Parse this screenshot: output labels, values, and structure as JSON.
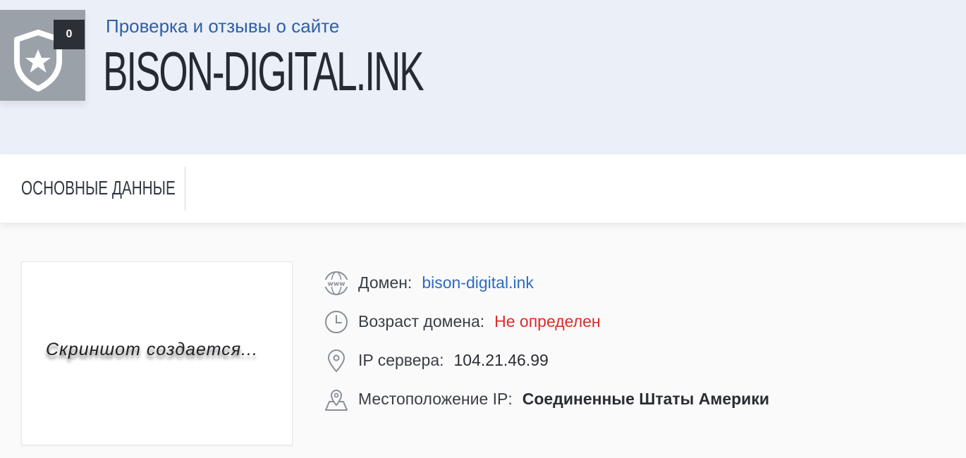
{
  "header": {
    "subtitle": "Проверка и отзывы о сайте",
    "title": "BISON-DIGITAL.INK",
    "badge_count": "0",
    "badge_icon": "shield-star-icon"
  },
  "tabs": [
    {
      "label": "ОСНОВНЫЕ ДАННЫЕ"
    }
  ],
  "preview": {
    "text": "Скриншот создается..."
  },
  "info": {
    "domain": {
      "icon": "www-globe-icon",
      "label": "Домен:",
      "value": "bison-digital.ink"
    },
    "age": {
      "icon": "clock-icon",
      "label": "Возраст домена:",
      "value": "Не определен"
    },
    "ip": {
      "icon": "map-pin-icon",
      "label": "IP сервера:",
      "value": "104.21.46.99"
    },
    "location": {
      "icon": "map-location-icon",
      "label": "Местоположение IP:",
      "value": "Соединенные Штаты Америки"
    }
  },
  "colors": {
    "header_bg": "#ebeff8",
    "accent_blue": "#2d5fa6",
    "link": "#2d6bc2",
    "warning_red": "#e02a2a",
    "badge_gray": "#9aa1a9",
    "badge_dark": "#2b2f36"
  }
}
